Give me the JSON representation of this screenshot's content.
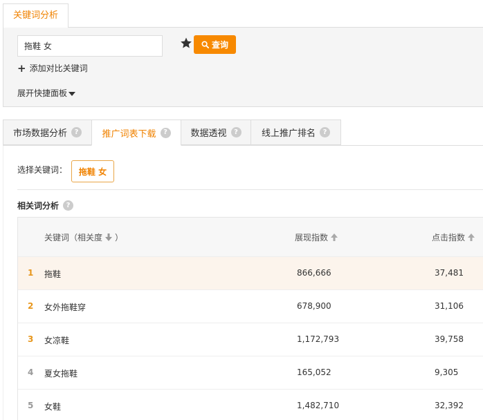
{
  "top_tab": {
    "label": "关键词分析"
  },
  "search": {
    "value": "拖鞋 女",
    "query_label": "查询",
    "add_compare_label": "添加对比关键词",
    "expand_panel_label": "展开快捷面板"
  },
  "tabs": [
    {
      "label": "市场数据分析",
      "active": false
    },
    {
      "label": "推广词表下载",
      "active": true
    },
    {
      "label": "数据透视",
      "active": false
    },
    {
      "label": "线上推广排名",
      "active": false
    }
  ],
  "select_keyword": {
    "label": "选择关键词：",
    "chip": "拖鞋 女"
  },
  "related": {
    "title": "相关词分析",
    "columns": {
      "keyword": "关键词（相关度",
      "impressions": "展现指数",
      "clicks": "点击指数"
    },
    "rows": [
      {
        "rank": "1",
        "keyword": "拖鞋",
        "impressions": "866,666",
        "clicks": "37,481"
      },
      {
        "rank": "2",
        "keyword": "女外拖鞋穿",
        "impressions": "678,900",
        "clicks": "31,106"
      },
      {
        "rank": "3",
        "keyword": "女凉鞋",
        "impressions": "1,172,793",
        "clicks": "39,758"
      },
      {
        "rank": "4",
        "keyword": "夏女拖鞋",
        "impressions": "165,052",
        "clicks": "9,305"
      },
      {
        "rank": "5",
        "keyword": "女鞋",
        "impressions": "1,482,710",
        "clicks": "32,392"
      }
    ]
  },
  "colors": {
    "accent": "#f08200",
    "button_bg": "#f78900",
    "rank_top": "#e7961c",
    "rank_other": "#999999",
    "row_highlight": "#fcf4ec"
  }
}
